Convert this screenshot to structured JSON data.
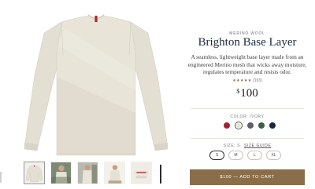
{
  "product": {
    "eyebrow": "MERINO WOOL",
    "title": "Brighton Base Layer",
    "description": "A seamless, lightweight base layer made from an engineered Merino mesh that wicks away moisture, regulates temperature and resists odor.",
    "rating": {
      "stars": "★★★★★",
      "count": "(193)",
      "value": 5
    },
    "price": {
      "currency": "$",
      "amount": "100"
    }
  },
  "color": {
    "label": "COLOR: IVORY",
    "swatches": [
      {
        "name": "red",
        "hex": "#a3222e"
      },
      {
        "name": "ivory",
        "hex": "#e7e2d3",
        "selected": true
      },
      {
        "name": "charcoal",
        "hex": "#5c6167"
      },
      {
        "name": "green",
        "hex": "#3f5b4b"
      },
      {
        "name": "navy",
        "hex": "#1f2640"
      }
    ]
  },
  "size": {
    "label": "SIZE: S",
    "guide": "SIZE GUIDE",
    "options": [
      "S",
      "M",
      "L",
      "XL"
    ],
    "selected": "S"
  },
  "cart": {
    "label": "$100 — ADD TO CART"
  },
  "colors": {
    "accent": "#8a6e4b",
    "garment": "#e5e1d5"
  }
}
